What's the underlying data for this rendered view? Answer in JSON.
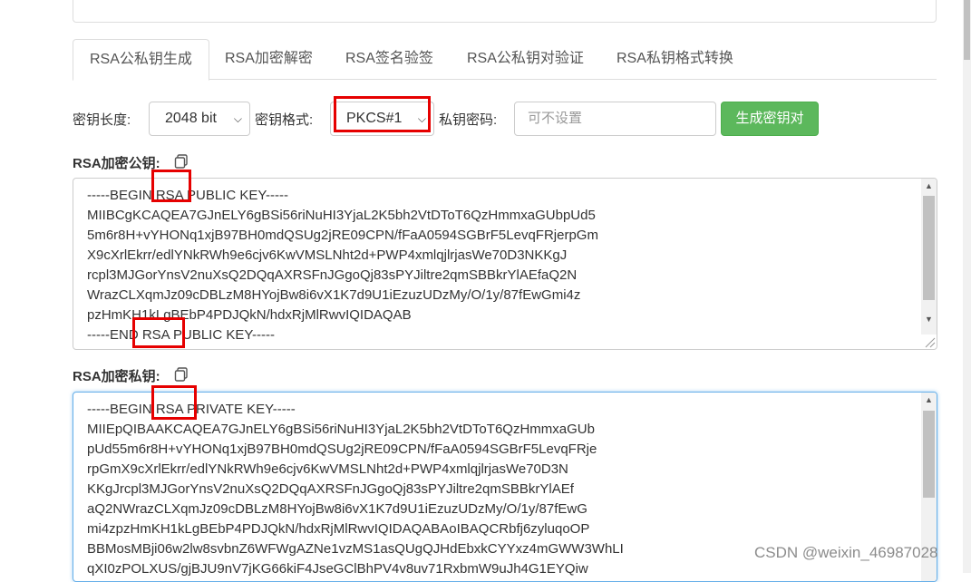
{
  "tabs": [
    {
      "label": "RSA公私钥生成",
      "active": true
    },
    {
      "label": "RSA加密解密",
      "active": false
    },
    {
      "label": "RSA签名验签",
      "active": false
    },
    {
      "label": "RSA公私钥对验证",
      "active": false
    },
    {
      "label": "RSA私钥格式转换",
      "active": false
    }
  ],
  "controls": {
    "key_length_label": "密钥长度:",
    "key_length_value": "2048 bit",
    "key_format_label": "密钥格式:",
    "key_format_value": "PKCS#1",
    "password_label": "私钥密码:",
    "password_placeholder": "可不设置",
    "generate_button": "生成密钥对"
  },
  "public_key": {
    "title": "RSA加密公钥:",
    "lines": [
      "-----BEGIN RSA PUBLIC KEY-----",
      "MIIBCgKCAQEA7GJnELY6gBSi56riNuHI3YjaL2K5bh2VtDToT6QzHmmxaGUbpUd5",
      "5m6r8H+vYHONq1xjB97BH0mdQSUg2jRE09CPN/fFaA0594SGBrF5LevqFRjerpGm",
      "X9cXrlEkrr/edlYNkRWh9e6cjv6KwVMSLNht2d+PWP4xmlqjlrjasWe70D3NKKgJ",
      "rcpl3MJGorYnsV2nuXsQ2DQqAXRSFnJGgoQj83sPYJiltre2qmSBBkrYlAEfaQ2N",
      "WrazCLXqmJz09cDBLzM8HYojBw8i6vX1K7d9U1iEzuzUDzMy/O/1y/87fEwGmi4z",
      "pzHmKH1kLgBEbP4PDJQkN/hdxRjMlRwvIQIDAQAB",
      "-----END RSA PUBLIC KEY-----"
    ]
  },
  "private_key": {
    "title": "RSA加密私钥:",
    "lines": [
      "-----BEGIN RSA PRIVATE KEY-----",
      "MIIEpQIBAAKCAQEA7GJnELY6gBSi56riNuHI3YjaL2K5bh2VtDToT6QzHmmxaGUb",
      "pUd55m6r8H+vYHONq1xjB97BH0mdQSUg2jRE09CPN/fFaA0594SGBrF5LevqFRje",
      "rpGmX9cXrlEkrr/edlYNkRWh9e6cjv6KwVMSLNht2d+PWP4xmlqjlrjasWe70D3N",
      "KKgJrcpl3MJGorYnsV2nuXsQ2DQqAXRSFnJGgoQj83sPYJiltre2qmSBBkrYlAEf",
      "aQ2NWrazCLXqmJz09cDBLzM8HYojBw8i6vX1K7d9U1iEzuzUDzMy/O/1y/87fEwG",
      "mi4zpzHmKH1kLgBEbP4PDJQkN/hdxRjMlRwvIQIDAQABAoIBAQCRbfj6zyluqoOP",
      "BBMosMBji06w2lw8svbnZ6WFWgAZNe1vzMS1asQUgQJHdEbxkCYYxz4mGWW3WhLI",
      "qXI0zPOLXUS/gjBJU9nV7jKG66kiF4JseGClBhPV4v8uv71RxbmW9uJh4G1EYQiw"
    ]
  },
  "watermark": "CSDN @weixin_46987028",
  "colors": {
    "highlight_box": "#e60000",
    "generate_button": "#5cb85c",
    "focus_border": "#66afe9"
  }
}
